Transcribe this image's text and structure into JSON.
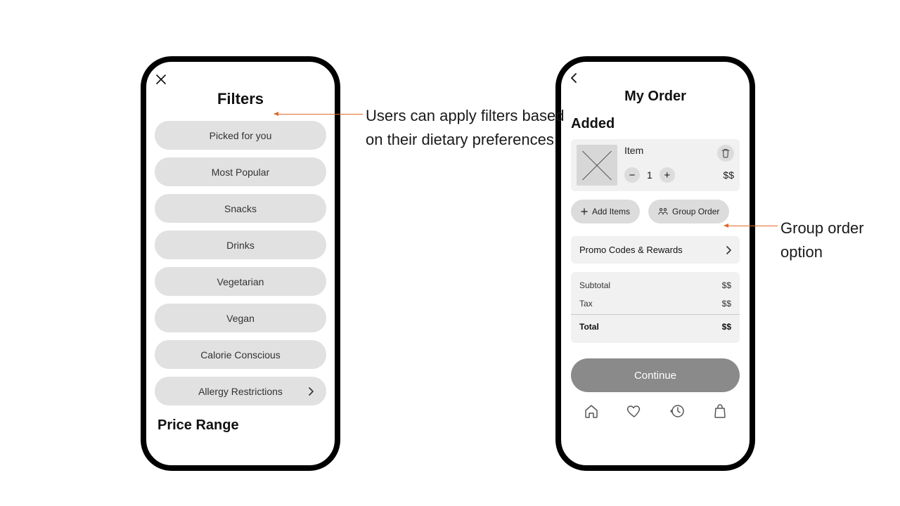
{
  "colors": {
    "accent_arrow": "#e06a2b",
    "pill_bg": "#e1e1e1"
  },
  "annotations": {
    "filters": "Users can apply filters based on their dietary preferences",
    "group": "Group order option"
  },
  "filters_screen": {
    "title": "Filters",
    "options": {
      "0": "Picked for you",
      "1": "Most Popular",
      "2": "Snacks",
      "3": "Drinks",
      "4": "Vegetarian",
      "5": "Vegan",
      "6": "Calorie Conscious",
      "7": "Allergy Restrictions"
    },
    "price_section_label": "Price Range"
  },
  "order_screen": {
    "title": "My Order",
    "added_heading": "Added",
    "item": {
      "name": "Item",
      "qty": "1",
      "price": "$$"
    },
    "actions": {
      "add_items": "Add Items",
      "group_order": "Group Order"
    },
    "promo_label": "Promo Codes & Rewards",
    "totals": {
      "subtotal_label": "Subtotal",
      "subtotal_value": "$$",
      "tax_label": "Tax",
      "tax_value": "$$",
      "total_label": "Total",
      "total_value": "$$"
    },
    "continue_label": "Continue"
  }
}
